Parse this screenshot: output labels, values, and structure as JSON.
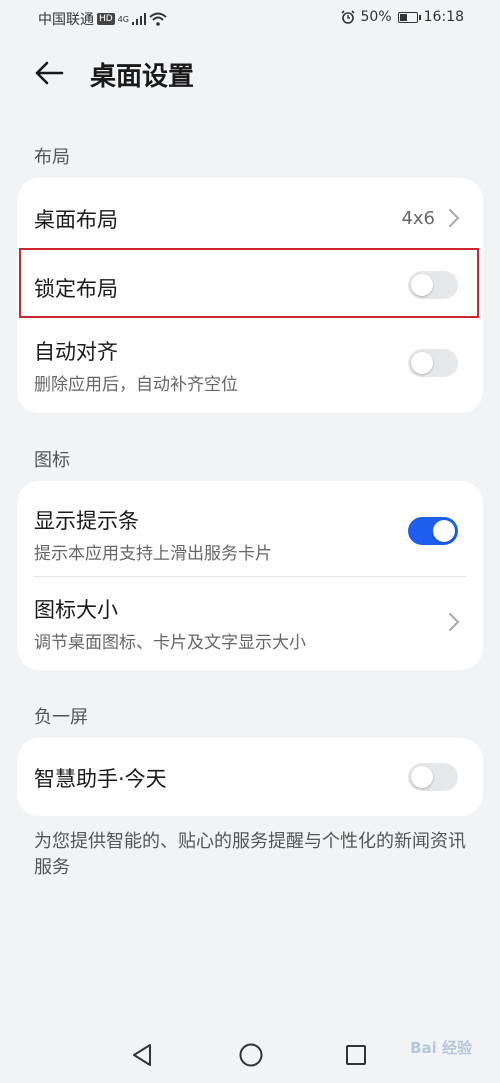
{
  "status_bar": {
    "carrier": "中国联通",
    "hd_badge": "HD",
    "network": "4G",
    "battery_percent": "50%",
    "time": "16:18",
    "battery_level": 0.5
  },
  "header": {
    "title": "桌面设置",
    "back_icon": "arrow-left-icon"
  },
  "sections": {
    "layout": {
      "label": "布局",
      "desktop_layout": {
        "title": "桌面布局",
        "value": "4x6"
      },
      "lock_layout": {
        "title": "锁定布局",
        "enabled": false
      },
      "auto_align": {
        "title": "自动对齐",
        "subtitle": "删除应用后，自动补齐空位",
        "enabled": false
      }
    },
    "icons": {
      "label": "图标",
      "show_indicator": {
        "title": "显示提示条",
        "subtitle": "提示本应用支持上滑出服务卡片",
        "enabled": true
      },
      "icon_size": {
        "title": "图标大小",
        "subtitle": "调节桌面图标、卡片及文字显示大小"
      }
    },
    "minus_one": {
      "label": "负一屏",
      "smart_assistant": {
        "title": "智慧助手·今天",
        "enabled": false
      },
      "description": "为您提供智能的、贴心的服务提醒与个性化的新闻资讯服务"
    }
  },
  "nav_bar": {
    "back_icon": "triangle-back-icon",
    "home_icon": "circle-home-icon",
    "recents_icon": "square-recents-icon"
  },
  "watermark": "Bai 经验",
  "colors": {
    "accent": "#1e5eee",
    "highlight": "#d0262e",
    "background": "#f1f3f5"
  }
}
